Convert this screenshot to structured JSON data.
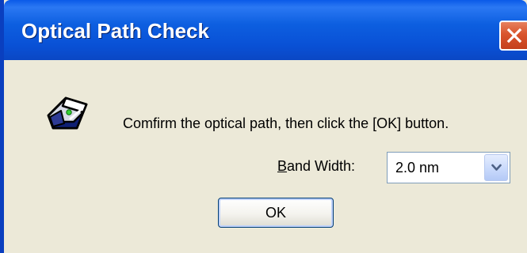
{
  "window": {
    "title": "Optical Path Check",
    "close_icon": "close-icon"
  },
  "dialog": {
    "icon": "optical-instrument-icon",
    "message": "Comfirm the optical path, then click the [OK] button.",
    "band_width": {
      "label_accel": "B",
      "label_rest": "and Width:",
      "selected_value": "2.0 nm"
    },
    "ok_label": "OK"
  },
  "colors": {
    "titlebar": "#0a5ae8",
    "close_button": "#d9542c",
    "dialog_background": "#ece9d8"
  }
}
